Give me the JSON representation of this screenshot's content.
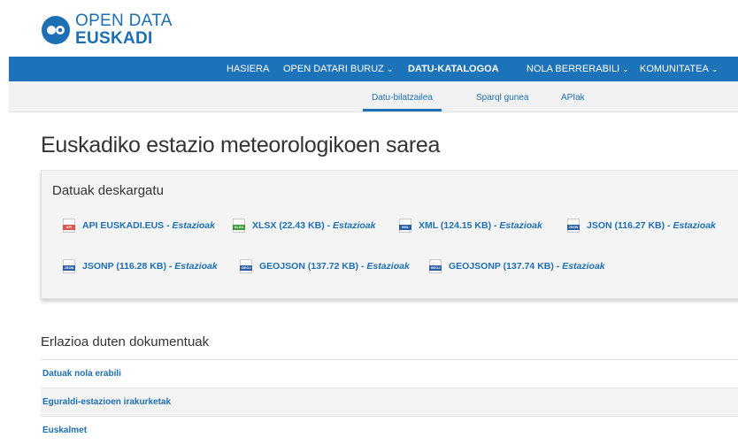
{
  "logo": {
    "line1": "OPEN DATA",
    "line2": "EUSKADI",
    "brand_color": "#1c6fb5"
  },
  "nav": {
    "items": [
      {
        "label": "HASIERA",
        "has_dropdown": false
      },
      {
        "label": "OPEN DATARI BURUZ",
        "has_dropdown": true
      },
      {
        "label": "DATU-KATALOGOA",
        "has_dropdown": false,
        "active": true
      },
      {
        "label": "NOLA BERRERABILI",
        "has_dropdown": true
      },
      {
        "label": "KOMUNITATEA",
        "has_dropdown": true
      }
    ],
    "chevron": "⌄"
  },
  "subnav": {
    "items": [
      {
        "label": "Datu-bilatzailea",
        "active": true
      },
      {
        "label": "Sparql gunea"
      },
      {
        "label": "APIak"
      }
    ]
  },
  "page": {
    "title": "Euskadiko estazio meteorologikoen sarea"
  },
  "downloads": {
    "title": "Datuak deskargatu",
    "items": [
      {
        "format": "API EUSKADI.EUS",
        "suffix": " - Estazioak",
        "icon": "api-file-icon",
        "icon_label": "API",
        "icon_color": "#d9534f"
      },
      {
        "format": "XLSX (22.43 KB)",
        "suffix": " - Estazioak",
        "icon": "xlsx-file-icon",
        "icon_label": "XLSX",
        "icon_color": "#3a9a3a"
      },
      {
        "format": "XML (124.15 KB)",
        "suffix": " - Estazioak",
        "icon": "xml-file-icon",
        "icon_label": "XML",
        "icon_color": "#2b5ea8"
      },
      {
        "format": "JSON (116.27 KB)",
        "suffix": " - Estazioak",
        "icon": "json-file-icon",
        "icon_label": "JSON",
        "icon_color": "#2b5ea8"
      },
      {
        "format": "JSONP (116.28 KB)",
        "suffix": " - Estazioak",
        "icon": "jsonp-file-icon",
        "icon_label": "JSON",
        "icon_color": "#2b5ea8"
      },
      {
        "format": "GEOJSON (137.72 KB)",
        "suffix": " - Estazioak",
        "icon": "geojson-file-icon",
        "icon_label": "GEOJ",
        "icon_color": "#2b5ea8"
      },
      {
        "format": "GEOJSONP (137.74 KB)",
        "suffix": " - Estazioak",
        "icon": "geojsonp-file-icon",
        "icon_label": "GEOJ",
        "icon_color": "#2b5ea8"
      }
    ]
  },
  "related": {
    "title": "Erlazioa duten dokumentuak",
    "items": [
      {
        "label": "Datuak nola erabili"
      },
      {
        "label": "Eguraldi-estazioen irakurketak"
      },
      {
        "label": "Euskalmet"
      }
    ]
  }
}
